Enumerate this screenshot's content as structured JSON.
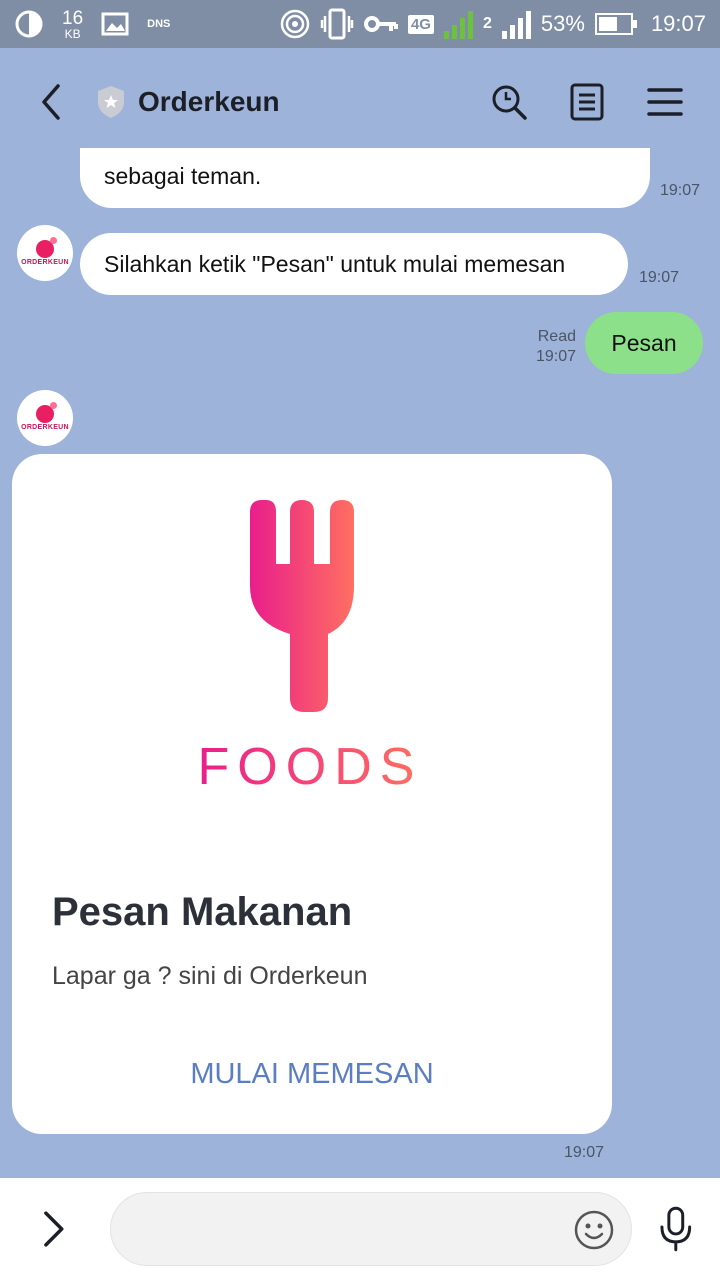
{
  "status_bar": {
    "kb_value": "16",
    "kb_unit": "KB",
    "dns": "DNS",
    "network": "4G",
    "sim2": "2",
    "battery": "53%",
    "time": "19:07"
  },
  "header": {
    "title": "Orderkeun",
    "icons": [
      "back-icon",
      "official-badge-icon",
      "search-icon",
      "notes-icon",
      "menu-icon"
    ]
  },
  "messages": [
    {
      "from": "bot",
      "text": "sebagai teman.",
      "time": "19:07"
    },
    {
      "from": "bot",
      "text": "Silahkan ketik \"Pesan\" untuk mulai memesan",
      "time": "19:07"
    },
    {
      "from": "user",
      "text": "Pesan",
      "status": "Read",
      "time": "19:07"
    }
  ],
  "avatar_label": "ORDERKEUN",
  "card": {
    "hero_text": "FOODS",
    "title": "Pesan Makanan",
    "subtitle": "Lapar ga ? sini di Orderkeun",
    "button": "MULAI MEMESAN",
    "time": "19:07"
  },
  "input": {
    "placeholder": ""
  },
  "colors": {
    "chat_bg": "#9db3d9",
    "sent_bubble": "#8de08a",
    "button_text": "#5b7ec2",
    "brand_gradient_start": "#e91e8c",
    "brand_gradient_end": "#ff6f61"
  }
}
